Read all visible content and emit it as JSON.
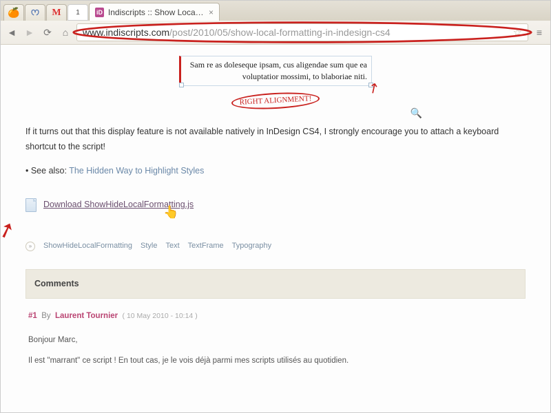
{
  "browser": {
    "tabs": {
      "active_title": "Indiscripts :: Show Local F…",
      "mini": [
        "🍊",
        "🦋",
        "M",
        "1"
      ]
    },
    "url_domain": "www.indiscripts.com",
    "url_path": "/post/2010/05/show-local-formatting-in-indesign-cs4"
  },
  "illustration": {
    "frame_text": "Sam re as doleseque ipsam, cus aligendae sum que ea voluptatior mossimi, to blaboriae niti.",
    "annotation": "RIGHT ALIGNMENT!"
  },
  "article": {
    "paragraph": "If it turns out that this display feature is not available natively in InDesign CS4, I strongly encourage you to attach a keyboard shortcut to the script!",
    "see_also_prefix": "• See also: ",
    "see_also_link": "The Hidden Way to Highlight Styles",
    "download_label": "Download ShowHideLocalFormatting.js"
  },
  "tags": [
    "ShowHideLocalFormatting",
    "Style",
    "Text",
    "TextFrame",
    "Typography"
  ],
  "comments": {
    "heading": "Comments",
    "items": [
      {
        "num": "#1",
        "by_label": "By",
        "author": "Laurent Tournier",
        "date": "( 10 May 2010 - 10:14 )",
        "body_lines": [
          "Bonjour Marc,",
          "Il est \"marrant\" ce script ! En tout cas, je le vois déjà parmi mes scripts utilisés au quotidien."
        ]
      }
    ]
  }
}
